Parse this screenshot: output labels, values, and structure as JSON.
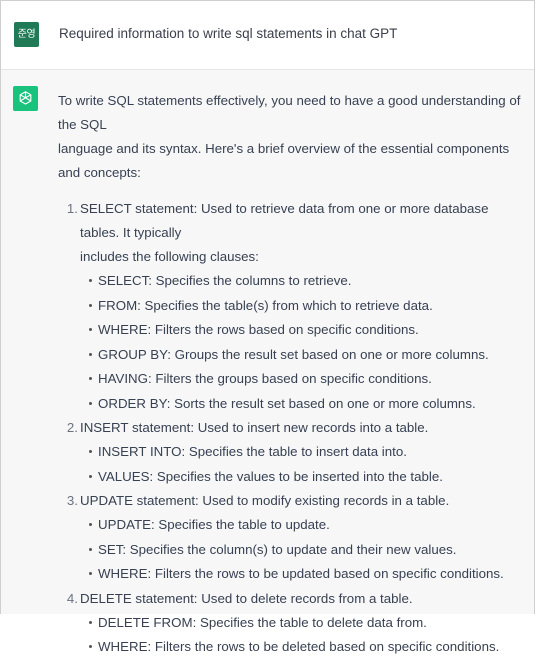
{
  "user_message": {
    "avatar_text": "준영",
    "text": "Required information to write sql statements in chat GPT"
  },
  "assistant_message": {
    "intro_line1": "To write SQL statements effectively, you need to have a good understanding of the SQL",
    "intro_line2": "language and its syntax. Here's a brief overview of the essential components and concepts:",
    "items": [
      {
        "number": "1.",
        "line1": "SELECT statement: Used to retrieve data from one or more database tables. It typically",
        "line2": "includes the following clauses:",
        "bullets": [
          "SELECT: Specifies the columns to retrieve.",
          "FROM: Specifies the table(s) from which to retrieve data.",
          "WHERE: Filters the rows based on specific conditions.",
          "GROUP BY: Groups the result set based on one or more columns.",
          "HAVING: Filters the groups based on specific conditions.",
          "ORDER BY: Sorts the result set based on one or more columns."
        ]
      },
      {
        "number": "2.",
        "line1": "INSERT statement: Used to insert new records into a table.",
        "bullets": [
          "INSERT INTO: Specifies the table to insert data into.",
          "VALUES: Specifies the values to be inserted into the table."
        ]
      },
      {
        "number": "3.",
        "line1": "UPDATE statement: Used to modify existing records in a table.",
        "bullets": [
          "UPDATE: Specifies the table to update.",
          "SET: Specifies the column(s) to update and their new values.",
          "WHERE: Filters the rows to be updated based on specific conditions."
        ]
      },
      {
        "number": "4.",
        "line1": "DELETE statement: Used to delete records from a table.",
        "bullets": [
          "DELETE FROM: Specifies the table to delete data from.",
          "WHERE: Filters the rows to be deleted based on specific conditions."
        ]
      }
    ]
  },
  "colors": {
    "user_avatar": "#1f7a55",
    "gpt_avatar": "#19c37d",
    "assistant_bg": "#f7f7f8"
  },
  "icons": {
    "gpt_avatar": "openai-logo-icon"
  }
}
